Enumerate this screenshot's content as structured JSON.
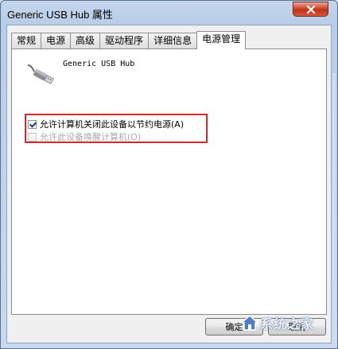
{
  "window": {
    "title": "Generic USB Hub 属性"
  },
  "tabs": [
    {
      "label": "常规",
      "active": false
    },
    {
      "label": "电源",
      "active": false
    },
    {
      "label": "高级",
      "active": false
    },
    {
      "label": "驱动程序",
      "active": false
    },
    {
      "label": "详细信息",
      "active": false
    },
    {
      "label": "电源管理",
      "active": true
    }
  ],
  "device": {
    "name": "Generic USB Hub",
    "icon": "usb-cable-icon"
  },
  "options": [
    {
      "label": "允许计算机关闭此设备以节约电源(A)",
      "checked": true,
      "enabled": true
    },
    {
      "label": "允许此设备唤醒计算机(O)",
      "checked": false,
      "enabled": false
    }
  ],
  "buttons": {
    "ok_label": "确定",
    "cancel_label": "取消"
  },
  "watermark": {
    "text": "系统之家"
  },
  "colors": {
    "highlight_border": "#d9262b",
    "close_button": "#c0321c"
  }
}
